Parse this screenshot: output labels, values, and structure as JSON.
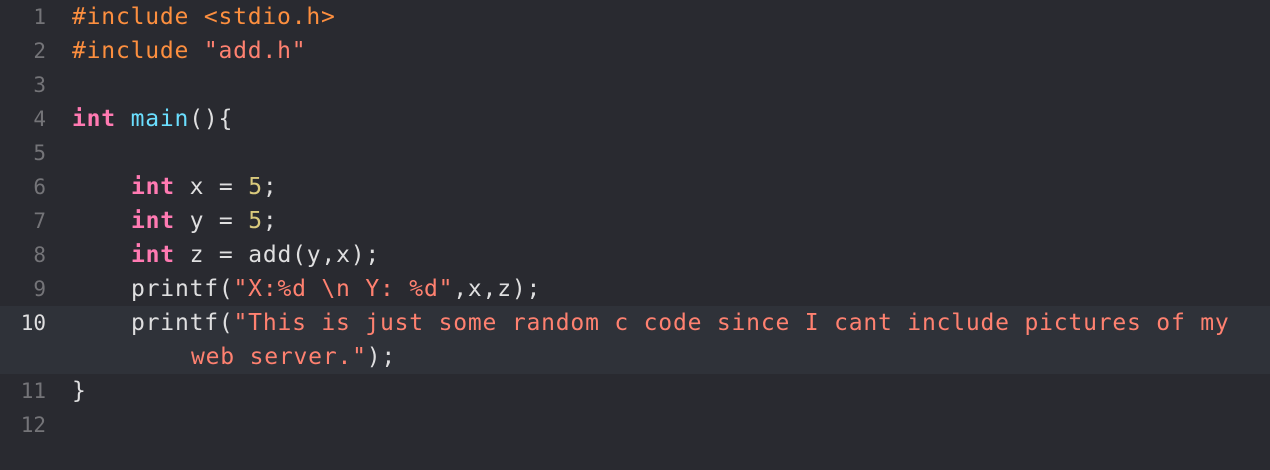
{
  "colors": {
    "background": "#292a30",
    "current_line": "#2f3239",
    "gutter": "#747478",
    "gutter_current": "#dfdfe0",
    "plain": "#dfdfe0",
    "keyword": "#ff7ab2",
    "preprocessor": "#fd8f3f",
    "string": "#ff8170",
    "number": "#d9c97c",
    "function_decl": "#6bdfff"
  },
  "current_line": 10,
  "lines": [
    {
      "n": "1"
    },
    {
      "n": "2"
    },
    {
      "n": "3"
    },
    {
      "n": "4"
    },
    {
      "n": "5"
    },
    {
      "n": "6"
    },
    {
      "n": "7"
    },
    {
      "n": "8"
    },
    {
      "n": "9"
    },
    {
      "n": "10"
    },
    {
      "n": "11"
    },
    {
      "n": "12"
    }
  ],
  "code": {
    "l1": {
      "pre": "#include <stdio.h>"
    },
    "l2": {
      "pre": "#include ",
      "str": "\"add.h\""
    },
    "l4": {
      "kw": "int",
      "fn": "main",
      "rest": "(){"
    },
    "l6": {
      "kw": "int",
      "a": " x = ",
      "num": "5",
      "b": ";"
    },
    "l7": {
      "kw": "int",
      "a": " y = ",
      "num": "5",
      "b": ";"
    },
    "l8": {
      "kw": "int",
      "a": " z = add(y,x);"
    },
    "l9": {
      "a": "printf(",
      "str": "\"X:%d \\n Y: %d\"",
      "b": ",x,z);"
    },
    "l10": {
      "a": "printf(",
      "str1": "\"This is just some random c code since I cant include pictures of my",
      "str2": "web server.\"",
      "b": ");"
    },
    "l11": {
      "a": "}"
    }
  }
}
